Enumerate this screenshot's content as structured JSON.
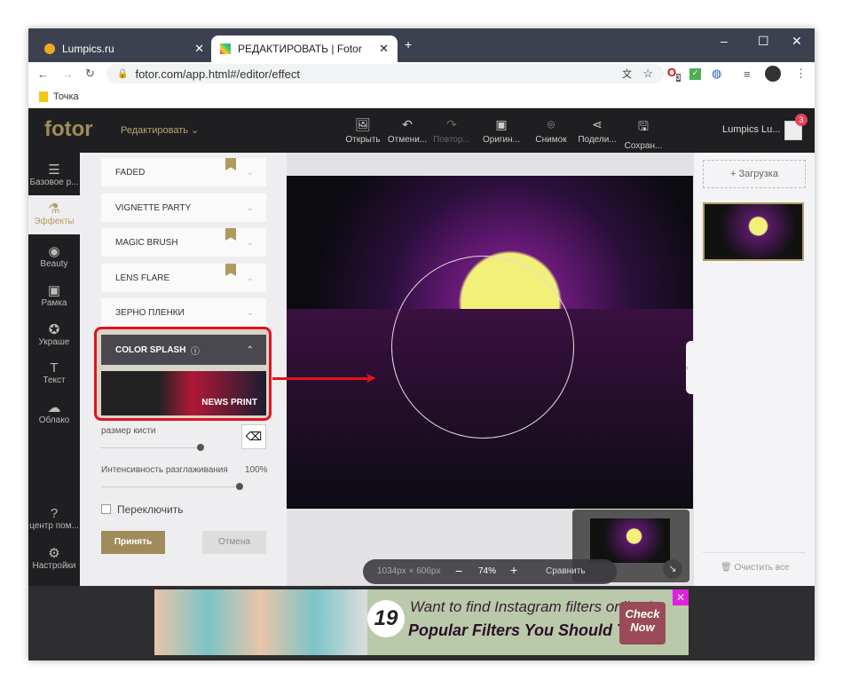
{
  "browser": {
    "tabs": [
      {
        "label": "Lumpics.ru"
      },
      {
        "label": "РЕДАКТИРОВАТЬ | Fotor"
      }
    ],
    "url": "fotor.com/app.html#/editor/effect",
    "bookmark": "Точка",
    "ext_badge": "3"
  },
  "app": {
    "logo": "fotor",
    "mode": "Редактировать",
    "toolbar": [
      "Открыть",
      "Отмени...",
      "Повтор...",
      "Оригин...",
      "Снимок",
      "Подели...",
      "Сохран..."
    ],
    "user": "Lumpics Lu...",
    "notif": "3",
    "nav": [
      "Базовое р...",
      "Эффекты",
      "Beauty",
      "Рамка",
      "Украше",
      "Текст",
      "Облако",
      "центр пом...",
      "Настройки"
    ],
    "effects": [
      "FADED",
      "VIGNETTE PARTY",
      "MAGIC BRUSH",
      "LENS FLARE",
      "ЗЕРНО ПЛЕНКИ"
    ],
    "active_effect": "COLOR SPLASH",
    "preset": "NEWS PRINT",
    "brush_label": "размер кисти",
    "smooth_label": "Интенсивность разглаживания",
    "smooth_value": "100%",
    "brush_level": 0.8,
    "smooth_level": 1.0,
    "toggle_label": "Переключить",
    "accept": "Принять",
    "cancel": "Отмена",
    "dims": "1034px × 606px",
    "zoom": "74%",
    "compare": "Сравнить",
    "upload": "+ Загрузка",
    "clear": "Очистить все"
  },
  "ad": {
    "number": "19",
    "line1": "Want to find Instagram filters online?",
    "line2": "Popular Filters You Should Try",
    "cta1": "Check",
    "cta2": "Now"
  },
  "colors": {
    "accent": "#a08c5a",
    "highlight": "#e0141e"
  }
}
